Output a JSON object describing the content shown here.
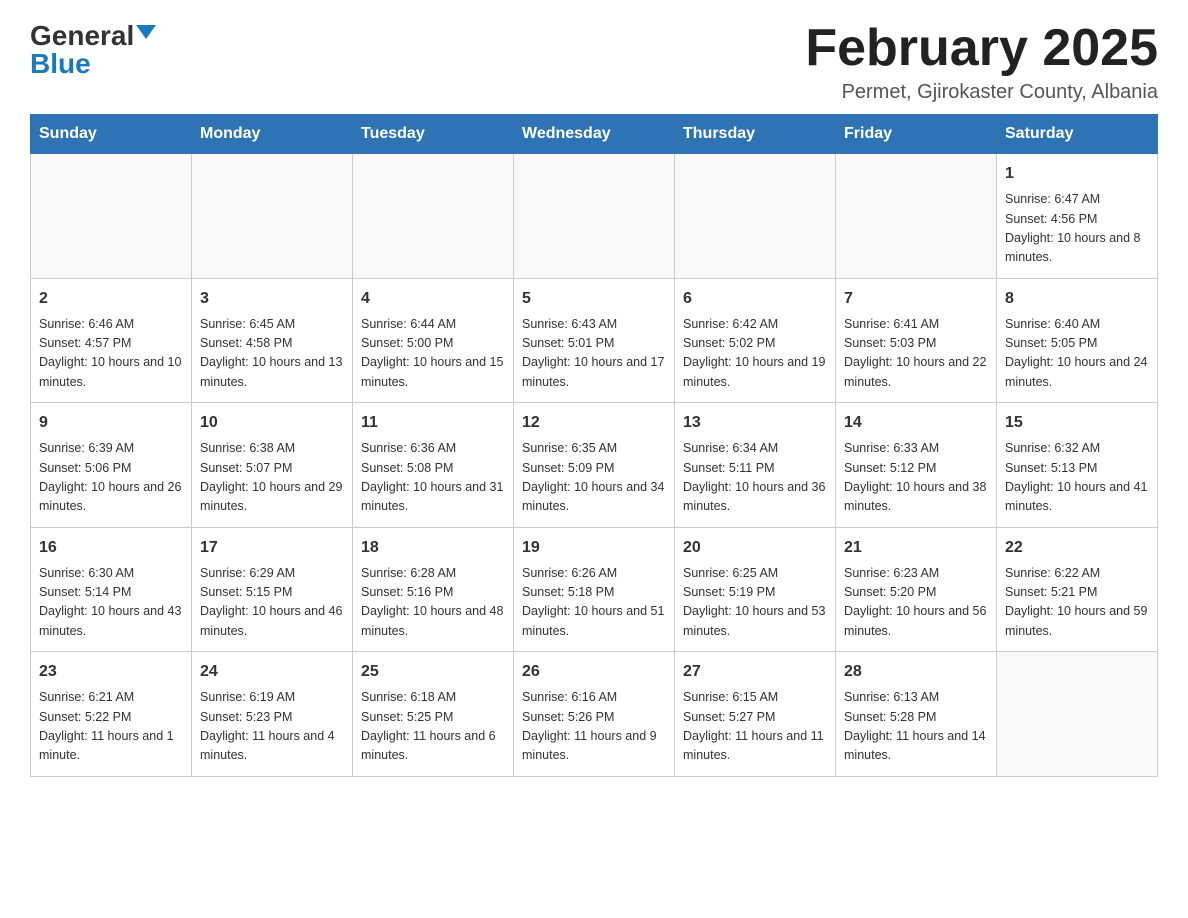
{
  "header": {
    "logo_main": "General",
    "logo_accent": "Blue",
    "month_title": "February 2025",
    "location": "Permet, Gjirokaster County, Albania"
  },
  "days_of_week": [
    "Sunday",
    "Monday",
    "Tuesday",
    "Wednesday",
    "Thursday",
    "Friday",
    "Saturday"
  ],
  "weeks": [
    [
      {
        "day": "",
        "sunrise": "",
        "sunset": "",
        "daylight": ""
      },
      {
        "day": "",
        "sunrise": "",
        "sunset": "",
        "daylight": ""
      },
      {
        "day": "",
        "sunrise": "",
        "sunset": "",
        "daylight": ""
      },
      {
        "day": "",
        "sunrise": "",
        "sunset": "",
        "daylight": ""
      },
      {
        "day": "",
        "sunrise": "",
        "sunset": "",
        "daylight": ""
      },
      {
        "day": "",
        "sunrise": "",
        "sunset": "",
        "daylight": ""
      },
      {
        "day": "1",
        "sunrise": "Sunrise: 6:47 AM",
        "sunset": "Sunset: 4:56 PM",
        "daylight": "Daylight: 10 hours and 8 minutes."
      }
    ],
    [
      {
        "day": "2",
        "sunrise": "Sunrise: 6:46 AM",
        "sunset": "Sunset: 4:57 PM",
        "daylight": "Daylight: 10 hours and 10 minutes."
      },
      {
        "day": "3",
        "sunrise": "Sunrise: 6:45 AM",
        "sunset": "Sunset: 4:58 PM",
        "daylight": "Daylight: 10 hours and 13 minutes."
      },
      {
        "day": "4",
        "sunrise": "Sunrise: 6:44 AM",
        "sunset": "Sunset: 5:00 PM",
        "daylight": "Daylight: 10 hours and 15 minutes."
      },
      {
        "day": "5",
        "sunrise": "Sunrise: 6:43 AM",
        "sunset": "Sunset: 5:01 PM",
        "daylight": "Daylight: 10 hours and 17 minutes."
      },
      {
        "day": "6",
        "sunrise": "Sunrise: 6:42 AM",
        "sunset": "Sunset: 5:02 PM",
        "daylight": "Daylight: 10 hours and 19 minutes."
      },
      {
        "day": "7",
        "sunrise": "Sunrise: 6:41 AM",
        "sunset": "Sunset: 5:03 PM",
        "daylight": "Daylight: 10 hours and 22 minutes."
      },
      {
        "day": "8",
        "sunrise": "Sunrise: 6:40 AM",
        "sunset": "Sunset: 5:05 PM",
        "daylight": "Daylight: 10 hours and 24 minutes."
      }
    ],
    [
      {
        "day": "9",
        "sunrise": "Sunrise: 6:39 AM",
        "sunset": "Sunset: 5:06 PM",
        "daylight": "Daylight: 10 hours and 26 minutes."
      },
      {
        "day": "10",
        "sunrise": "Sunrise: 6:38 AM",
        "sunset": "Sunset: 5:07 PM",
        "daylight": "Daylight: 10 hours and 29 minutes."
      },
      {
        "day": "11",
        "sunrise": "Sunrise: 6:36 AM",
        "sunset": "Sunset: 5:08 PM",
        "daylight": "Daylight: 10 hours and 31 minutes."
      },
      {
        "day": "12",
        "sunrise": "Sunrise: 6:35 AM",
        "sunset": "Sunset: 5:09 PM",
        "daylight": "Daylight: 10 hours and 34 minutes."
      },
      {
        "day": "13",
        "sunrise": "Sunrise: 6:34 AM",
        "sunset": "Sunset: 5:11 PM",
        "daylight": "Daylight: 10 hours and 36 minutes."
      },
      {
        "day": "14",
        "sunrise": "Sunrise: 6:33 AM",
        "sunset": "Sunset: 5:12 PM",
        "daylight": "Daylight: 10 hours and 38 minutes."
      },
      {
        "day": "15",
        "sunrise": "Sunrise: 6:32 AM",
        "sunset": "Sunset: 5:13 PM",
        "daylight": "Daylight: 10 hours and 41 minutes."
      }
    ],
    [
      {
        "day": "16",
        "sunrise": "Sunrise: 6:30 AM",
        "sunset": "Sunset: 5:14 PM",
        "daylight": "Daylight: 10 hours and 43 minutes."
      },
      {
        "day": "17",
        "sunrise": "Sunrise: 6:29 AM",
        "sunset": "Sunset: 5:15 PM",
        "daylight": "Daylight: 10 hours and 46 minutes."
      },
      {
        "day": "18",
        "sunrise": "Sunrise: 6:28 AM",
        "sunset": "Sunset: 5:16 PM",
        "daylight": "Daylight: 10 hours and 48 minutes."
      },
      {
        "day": "19",
        "sunrise": "Sunrise: 6:26 AM",
        "sunset": "Sunset: 5:18 PM",
        "daylight": "Daylight: 10 hours and 51 minutes."
      },
      {
        "day": "20",
        "sunrise": "Sunrise: 6:25 AM",
        "sunset": "Sunset: 5:19 PM",
        "daylight": "Daylight: 10 hours and 53 minutes."
      },
      {
        "day": "21",
        "sunrise": "Sunrise: 6:23 AM",
        "sunset": "Sunset: 5:20 PM",
        "daylight": "Daylight: 10 hours and 56 minutes."
      },
      {
        "day": "22",
        "sunrise": "Sunrise: 6:22 AM",
        "sunset": "Sunset: 5:21 PM",
        "daylight": "Daylight: 10 hours and 59 minutes."
      }
    ],
    [
      {
        "day": "23",
        "sunrise": "Sunrise: 6:21 AM",
        "sunset": "Sunset: 5:22 PM",
        "daylight": "Daylight: 11 hours and 1 minute."
      },
      {
        "day": "24",
        "sunrise": "Sunrise: 6:19 AM",
        "sunset": "Sunset: 5:23 PM",
        "daylight": "Daylight: 11 hours and 4 minutes."
      },
      {
        "day": "25",
        "sunrise": "Sunrise: 6:18 AM",
        "sunset": "Sunset: 5:25 PM",
        "daylight": "Daylight: 11 hours and 6 minutes."
      },
      {
        "day": "26",
        "sunrise": "Sunrise: 6:16 AM",
        "sunset": "Sunset: 5:26 PM",
        "daylight": "Daylight: 11 hours and 9 minutes."
      },
      {
        "day": "27",
        "sunrise": "Sunrise: 6:15 AM",
        "sunset": "Sunset: 5:27 PM",
        "daylight": "Daylight: 11 hours and 11 minutes."
      },
      {
        "day": "28",
        "sunrise": "Sunrise: 6:13 AM",
        "sunset": "Sunset: 5:28 PM",
        "daylight": "Daylight: 11 hours and 14 minutes."
      },
      {
        "day": "",
        "sunrise": "",
        "sunset": "",
        "daylight": ""
      }
    ]
  ]
}
